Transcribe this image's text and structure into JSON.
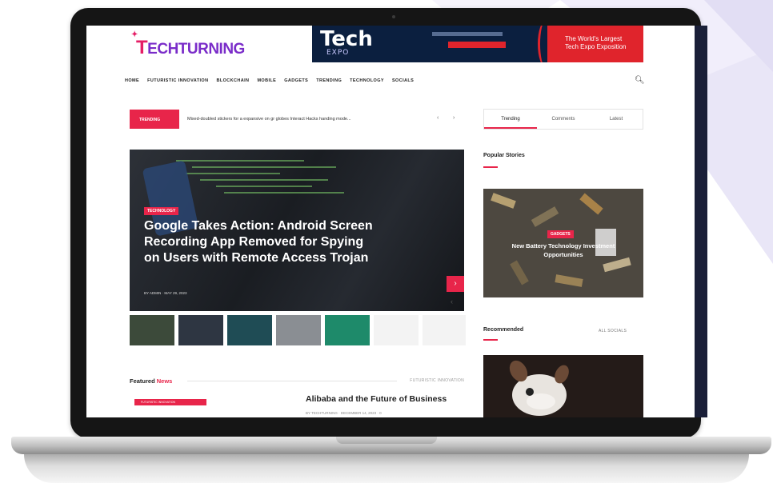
{
  "logo": {
    "first_letter": "T",
    "rest": "ECHTURNING"
  },
  "banner": {
    "brand": "Tech",
    "brand_sub": "EXPO",
    "right_line1": "The World's Largest",
    "right_line2": "Tech Expo Exposition"
  },
  "nav": {
    "items": [
      "HOME",
      "FUTURISTIC INNOVATION",
      "BLOCKCHAIN",
      "MOBILE",
      "GADGETS",
      "TRENDING",
      "TECHNOLOGY",
      "SOCIALS"
    ]
  },
  "ticker": {
    "badge": "TRENDING",
    "text": "Mixed-doubled stickers for a expansive on gr globes Interact Hacks handing mode..."
  },
  "tabs": [
    "Trending",
    "Comments",
    "Latest"
  ],
  "hero": {
    "category": "TECHNOLOGY",
    "title": "Google Takes Action: Android Screen Recording App Removed for Spying on Users with Remote Access Trojan",
    "meta": "BY ADMIN · MAY 29, 2023"
  },
  "featured": {
    "title_main": "Featured ",
    "title_accent": "News",
    "filter": "FUTURISTIC INNOVATION"
  },
  "article": {
    "category": "FUTURISTIC INNOVATION",
    "title": "Alibaba and the Future of Business",
    "meta": "BY TECHTURNING · DECEMBER 14, 2023 · 0"
  },
  "popular": {
    "heading": "Popular Stories",
    "category": "GADGETS",
    "title": "New Battery Technology Investment Opportunities"
  },
  "recommended": {
    "heading": "Recommended",
    "filter": "ALL   SOCIALS"
  },
  "colors": {
    "accent": "#e8254a",
    "brand": "#7a2cc9",
    "lid": "#151515"
  }
}
